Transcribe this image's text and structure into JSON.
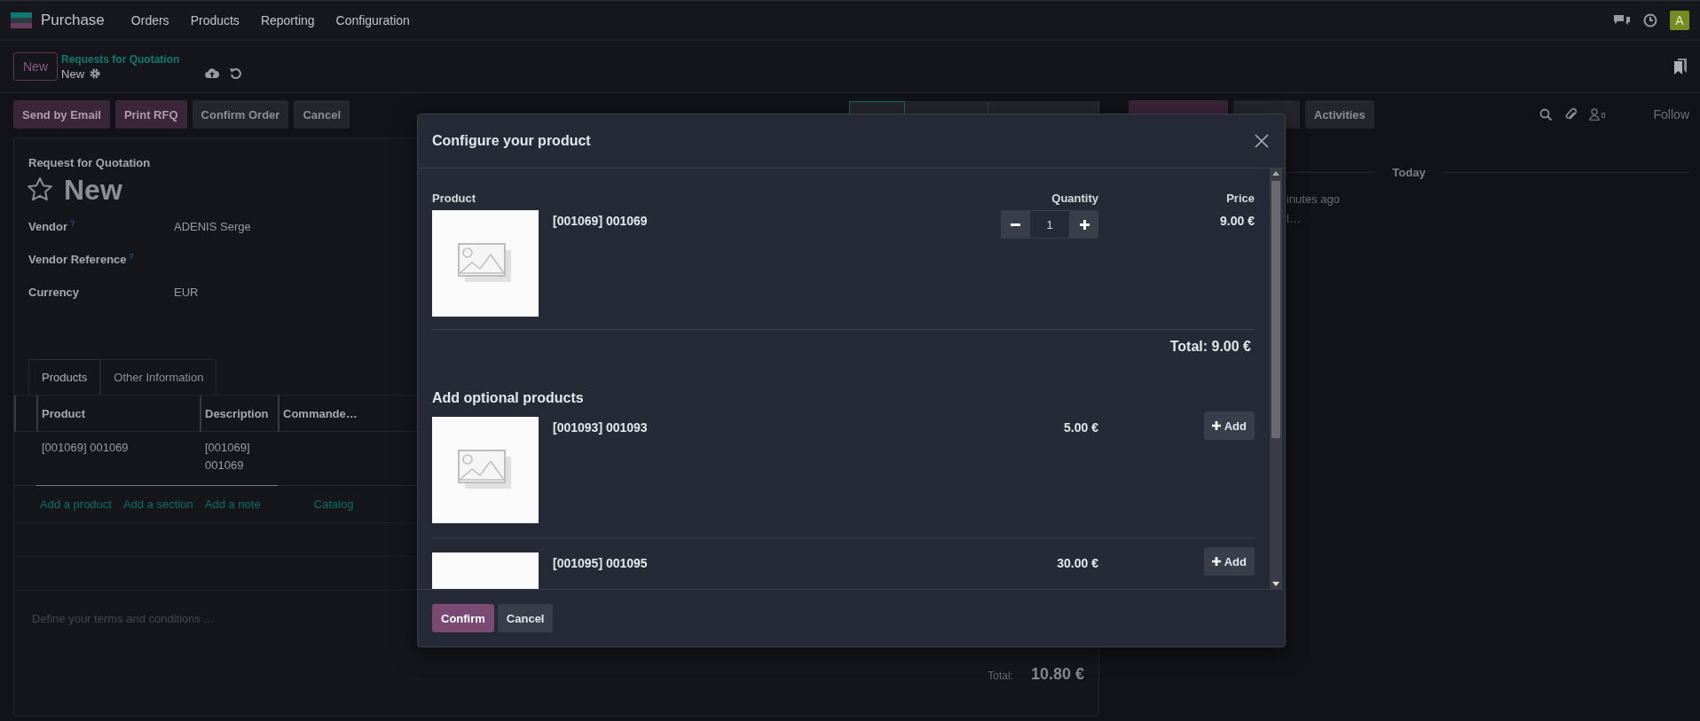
{
  "navbar": {
    "app_name": "Purchase",
    "menu": [
      "Orders",
      "Products",
      "Reporting",
      "Configuration"
    ],
    "avatar": "A"
  },
  "control_panel": {
    "new_button": "New",
    "breadcrumb": "Requests for Quotation",
    "record": "New"
  },
  "actions": [
    {
      "label": "Send by Email",
      "kind": "primary"
    },
    {
      "label": "Print RFQ",
      "kind": "primary"
    },
    {
      "label": "Confirm Order",
      "kind": "secondary"
    },
    {
      "label": "Cancel",
      "kind": "secondary"
    }
  ],
  "status_steps": [
    {
      "selected": true
    },
    {
      "selected": false
    },
    {
      "selected": false
    }
  ],
  "form": {
    "heading": "Request for Quotation",
    "title": "New",
    "starred": false,
    "fields": [
      {
        "label": "Vendor",
        "help": "?",
        "value": "ADENIS  Serge"
      },
      {
        "label": "Vendor Reference",
        "help": "?"
      },
      {
        "label": "Currency",
        "value": "EUR"
      }
    ],
    "tabs": [
      {
        "label": "Products",
        "selected": true
      },
      {
        "label": "Other Information",
        "selected": false
      }
    ],
    "table": {
      "columns": [
        "Product",
        "Description",
        "Commande…"
      ],
      "rows": [
        [
          "[001069] 001069",
          "[001069] 001069"
        ]
      ]
    },
    "links": [
      "Add a product",
      "Add a section",
      "Add a note",
      "Catalog"
    ],
    "terms_placeholder": "Define your terms and conditions ...",
    "total_label": "Total:",
    "total": "10.80 €"
  },
  "chatter": {
    "buttons": [
      {
        "kind": "primary"
      },
      {
        "kind": "secondary"
      },
      {
        "label": "Activities",
        "kind": "secondary"
      }
    ],
    "follower_count": "0",
    "follow": "Follow",
    "separator": "Today",
    "message_time": "inutes ago",
    "message_body": "l…"
  },
  "dialog": {
    "title": "Configure your product",
    "columns": [
      "Product",
      "Quantity",
      "Price"
    ],
    "product": {
      "name": "[001069] 001069",
      "quantity": "1",
      "price": "9.00 €"
    },
    "total": "Total: 9.00 €",
    "optional_title": "Add optional products",
    "optional": [
      {
        "name": "[001093] 001093",
        "price": "5.00 €",
        "button": "Add"
      },
      {
        "name": "[001095] 001095",
        "price": "30.00 €",
        "button": "Add"
      }
    ],
    "buttons": [
      {
        "label": "Confirm",
        "kind": "primary"
      },
      {
        "label": "Cancel",
        "kind": "secondary"
      }
    ]
  }
}
